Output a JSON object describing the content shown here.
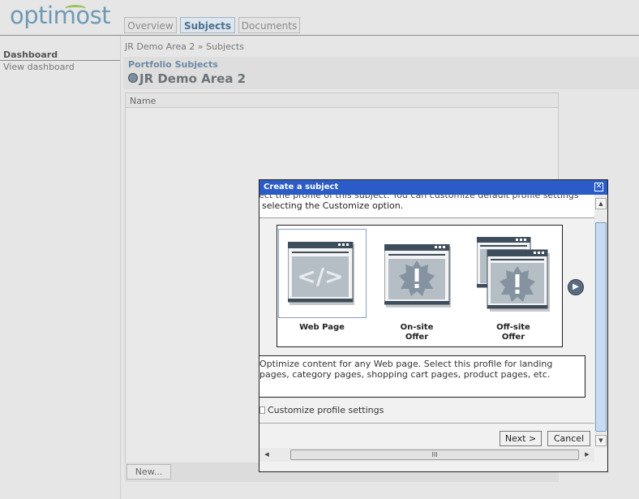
{
  "app": {
    "logo_text": "optimost"
  },
  "tabs": [
    {
      "label": "Overview",
      "active": false
    },
    {
      "label": "Subjects",
      "active": true
    },
    {
      "label": "Documents",
      "active": false
    }
  ],
  "nav": {
    "heading": "Dashboard",
    "link": "View dashboard"
  },
  "breadcrumb": "JR Demo Area 2 » Subjects",
  "page": {
    "subtitle": "Portfolio Subjects",
    "title": "JR Demo Area 2"
  },
  "grid": {
    "column_name": "Name",
    "new_button": "New..."
  },
  "dialog": {
    "title": "Create a subject",
    "close_glyph": "✕",
    "instruction_line1": "ect the profile of this subject. You can customize default profile settings",
    "instruction_line2": "selecting the Customize option.",
    "profiles": [
      {
        "label": "Web Page",
        "selected": true
      },
      {
        "label": "On-site\nOffer",
        "selected": false
      },
      {
        "label": "Off-site\nOffer",
        "selected": false
      }
    ],
    "next_arrow_glyph": "▶",
    "description": "Optimize content for any Web page. Select this profile for landing pages, category pages, shopping cart pages, product pages, etc.",
    "customize_label": "Customize profile settings",
    "next_button": "Next >",
    "cancel_button": "Cancel",
    "hscroll_grip": "III"
  },
  "colors": {
    "title_bar": "#2a5bc7",
    "accent": "#6f9ab5",
    "tab_active": "#4c6f8c"
  }
}
